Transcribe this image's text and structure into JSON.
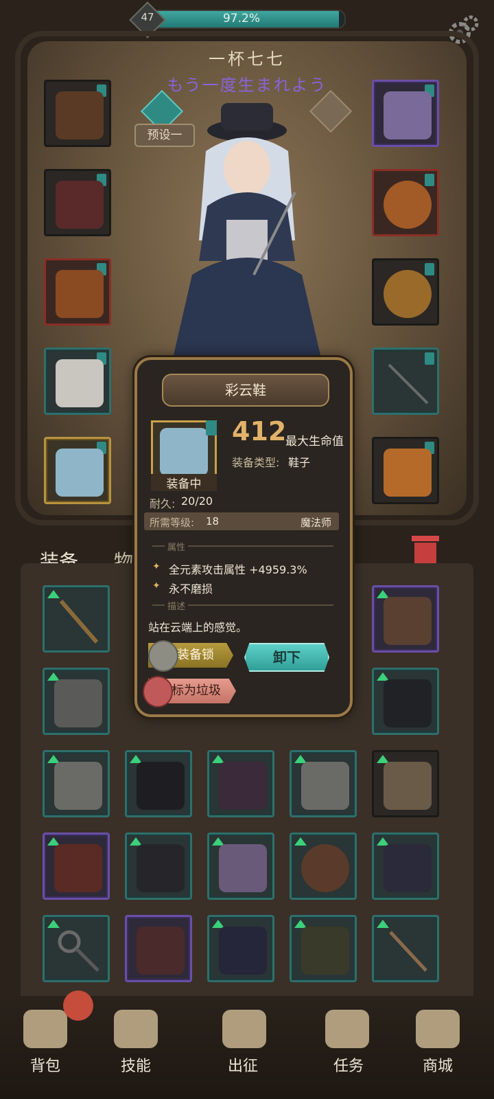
{
  "top": {
    "level": "47",
    "xp_percent_text": "97.2%",
    "xp_fraction": 0.972
  },
  "character": {
    "name": "一杯七七",
    "title": "もう一度生まれよう",
    "preset_label": "预设一"
  },
  "tabs": {
    "equip": "装备",
    "items": "物品"
  },
  "popup": {
    "name": "彩云鞋",
    "stat_value": "412",
    "stat_label": "最大生命值",
    "type_label": "装备类型:",
    "type_value": "鞋子",
    "equipped_label": "装备中",
    "durability_label": "耐久:",
    "durability_value": "20/20",
    "req_level_label": "所需等级:",
    "req_level_value": "18",
    "req_class": "魔法师",
    "attr_header": "属性",
    "attributes": [
      "全元素攻击属性 +4959.3%",
      "永不磨损"
    ],
    "desc_header": "描述",
    "description": "站在云端上的感觉。",
    "lock_label": "装备锁",
    "unequip_label": "卸下",
    "junk_label": "标为垃圾"
  },
  "nav": {
    "bag": "背包",
    "skills": "技能",
    "battle": "出征",
    "quests": "任务",
    "shop": "商城"
  },
  "colors": {
    "accent_teal": "#2f8a84",
    "rarity_purple": "#6a4fa8",
    "rarity_gold": "#b89440",
    "upgrade_green": "#3bd07a",
    "stat_gold": "#e2b26a"
  }
}
